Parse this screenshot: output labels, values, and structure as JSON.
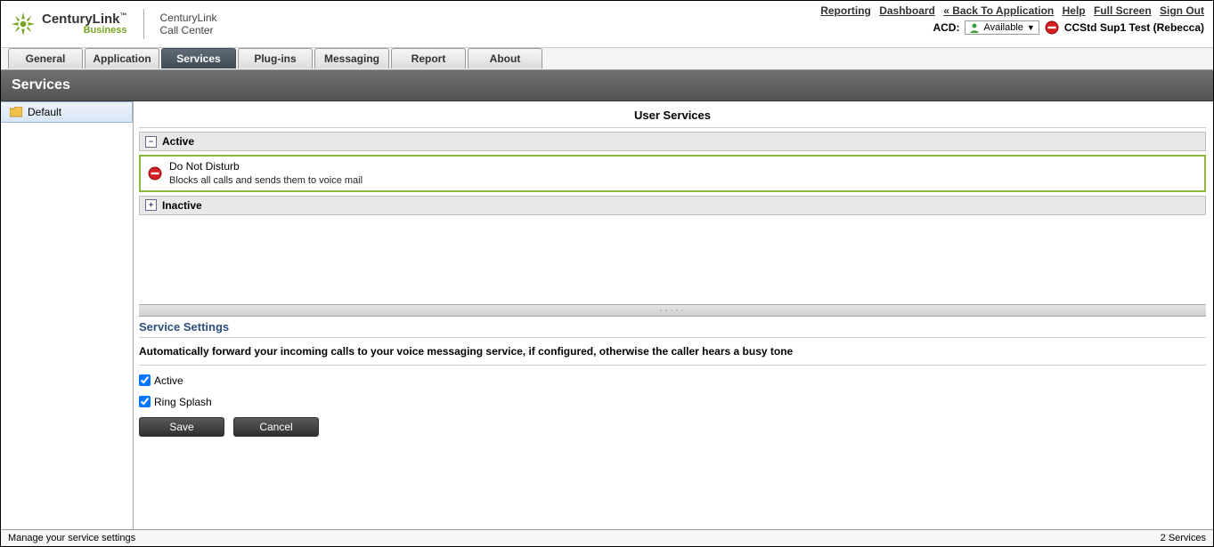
{
  "header": {
    "brand_main": "CenturyLink",
    "brand_tm": "™",
    "brand_sub": "Business",
    "app_line1": "CenturyLink",
    "app_line2": "Call Center"
  },
  "top_links": {
    "reporting": "Reporting",
    "dashboard": "Dashboard",
    "back": "« Back To Application",
    "help": "Help",
    "full_screen": "Full Screen",
    "sign_out": "Sign Out"
  },
  "acd": {
    "label": "ACD:",
    "status": "Available",
    "user": "CCStd Sup1 Test (Rebecca)"
  },
  "tabs": {
    "general": "General",
    "application": "Application",
    "services": "Services",
    "plugins": "Plug-ins",
    "messaging": "Messaging",
    "report": "Report",
    "about": "About"
  },
  "titlebar": "Services",
  "sidebar": {
    "default": "Default"
  },
  "panel": {
    "title": "User Services",
    "active_label": "Active",
    "inactive_label": "Inactive",
    "dnd_title": "Do Not Disturb",
    "dnd_desc": "Blocks all calls and sends them to voice mail"
  },
  "settings": {
    "title": "Service Settings",
    "description": "Automatically forward your incoming calls to your voice messaging service, if configured, otherwise the caller hears a busy tone",
    "active_label": "Active",
    "ring_splash_label": "Ring Splash",
    "save": "Save",
    "cancel": "Cancel",
    "active_checked": true,
    "ring_splash_checked": true
  },
  "status": {
    "left": "Manage your service settings",
    "right": "2 Services"
  }
}
